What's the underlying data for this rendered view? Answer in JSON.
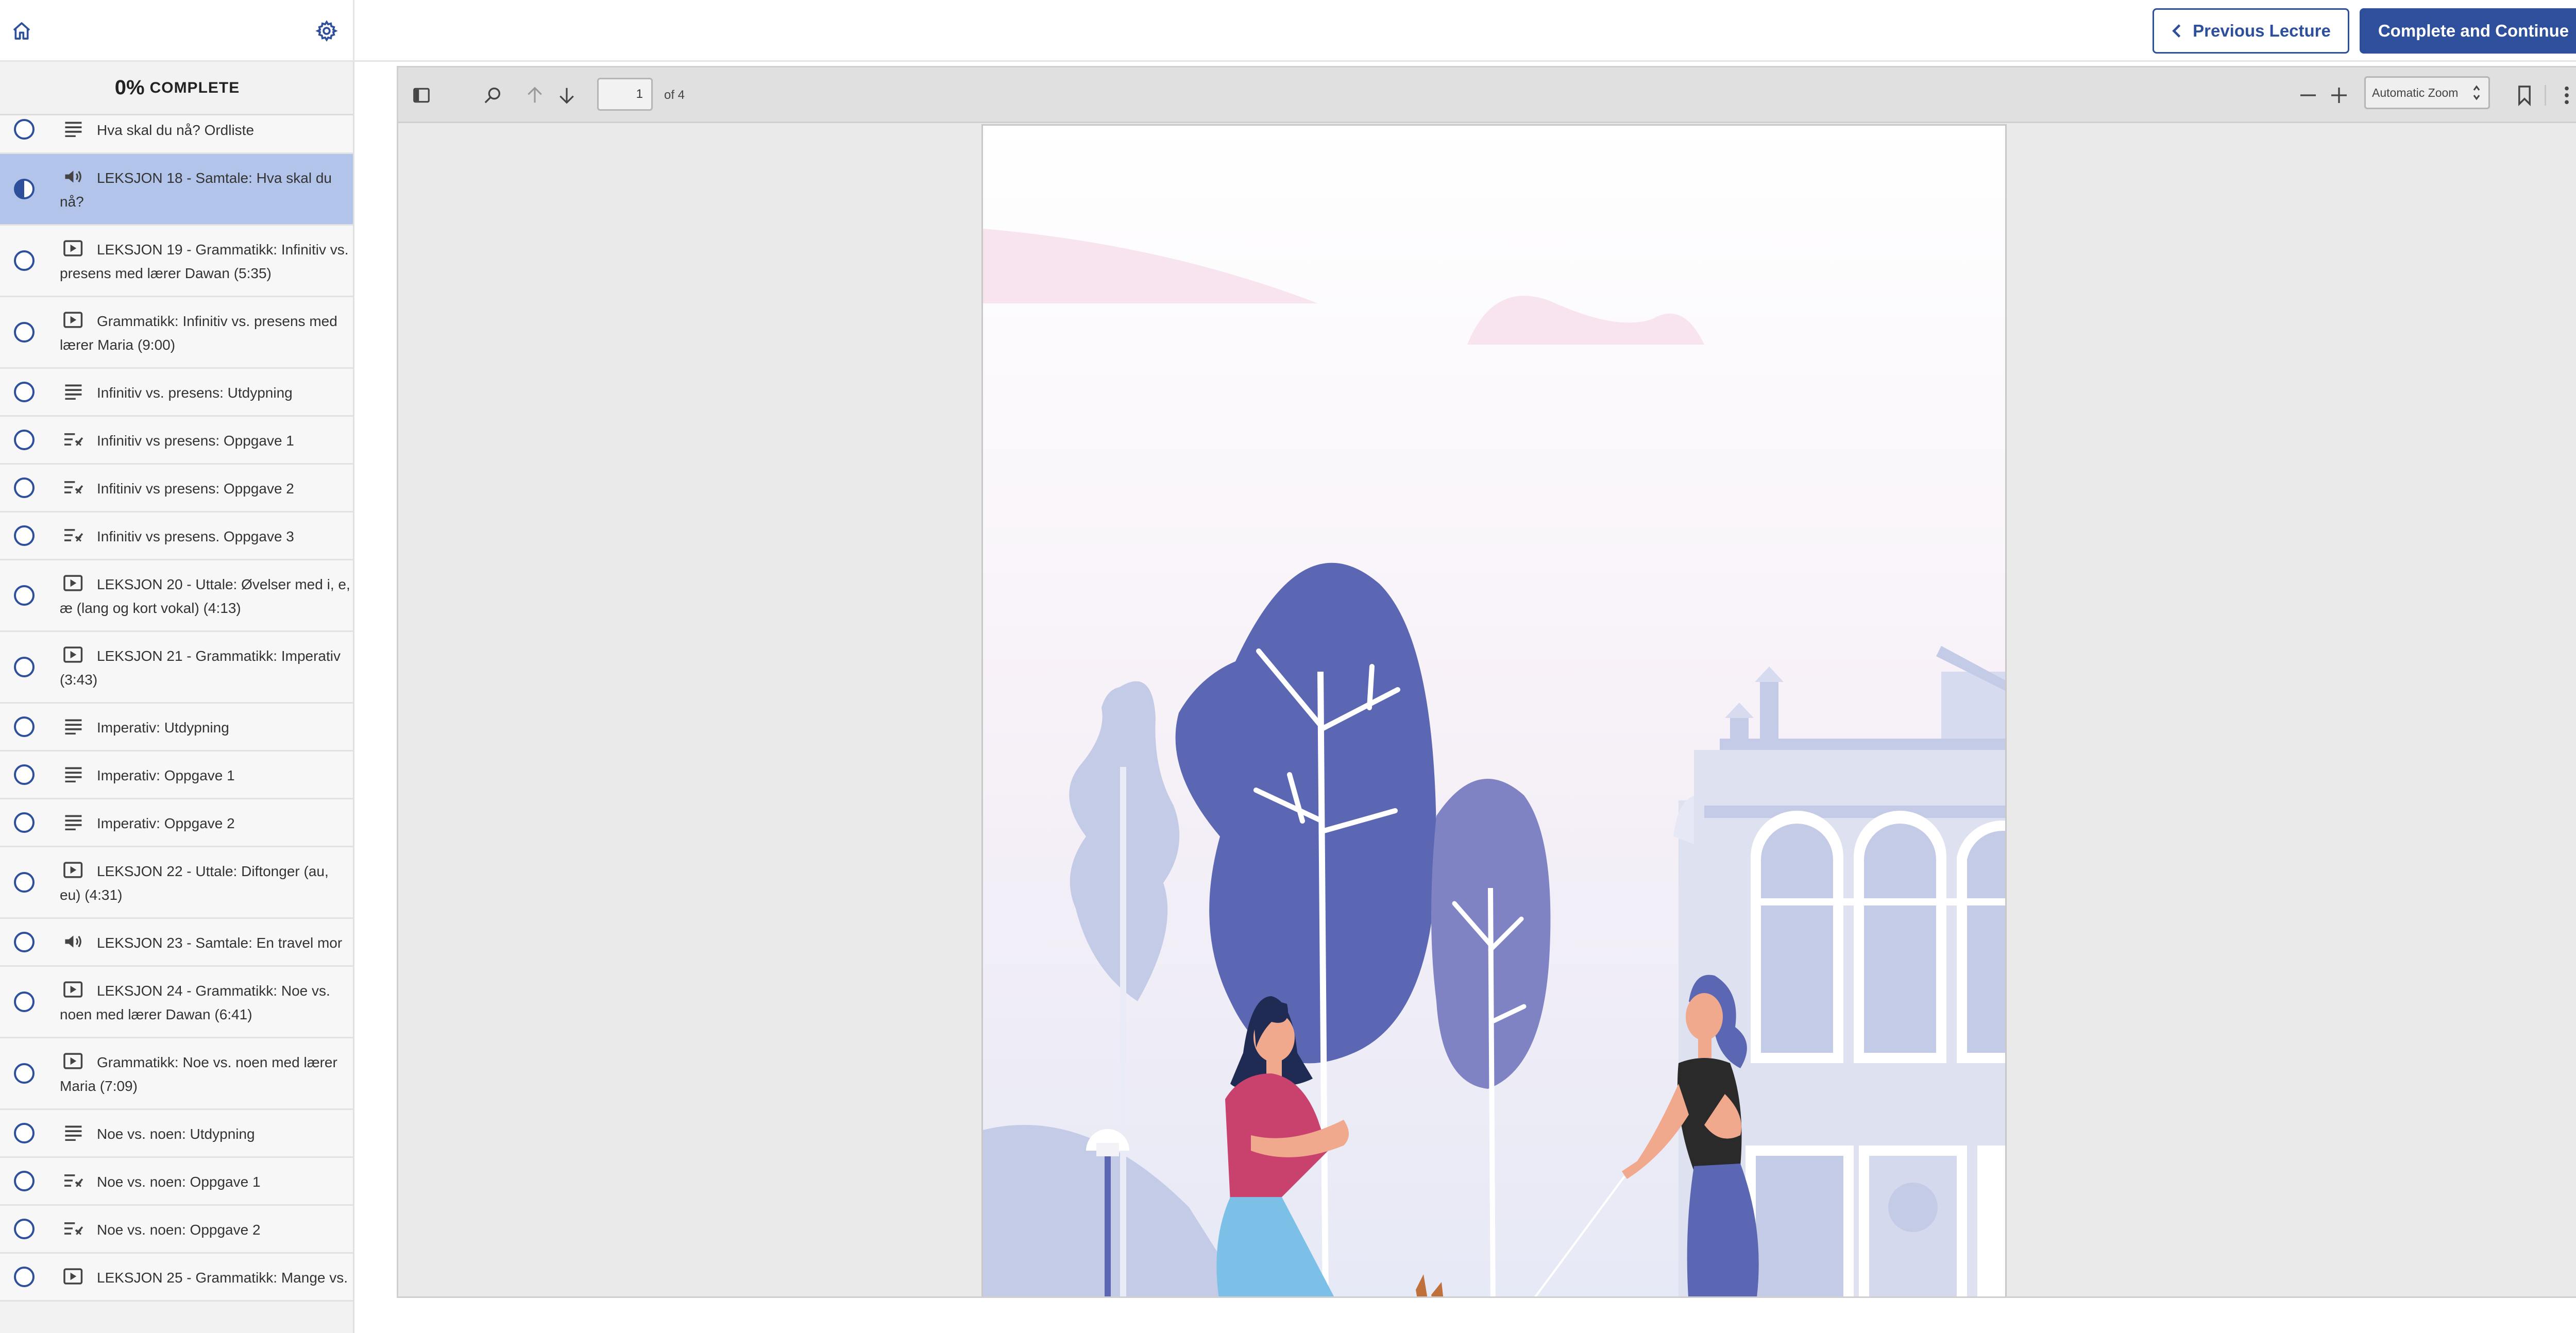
{
  "header": {
    "prev_label": "Previous Lecture",
    "next_label": "Complete and Continue"
  },
  "sidebar": {
    "progress_percent": "0%",
    "progress_label": "COMPLETE",
    "lectures": [
      {
        "type": "text",
        "title": "Hva skal du nå? Ordliste",
        "status": "empty"
      },
      {
        "type": "audio",
        "title": "LEKSJON 18 - Samtale: Hva skal du nå?",
        "status": "half",
        "active": true
      },
      {
        "type": "video",
        "title": "LEKSJON 19 - Grammatikk: Infinitiv vs. presens med lærer Dawan (5:35)",
        "status": "empty"
      },
      {
        "type": "video",
        "title": "Grammatikk: Infinitiv vs. presens med lærer Maria (9:00)",
        "status": "empty"
      },
      {
        "type": "text",
        "title": "Infinitiv vs. presens: Utdypning",
        "status": "empty"
      },
      {
        "type": "quiz",
        "title": "Infinitiv vs presens: Oppgave 1",
        "status": "empty"
      },
      {
        "type": "quiz",
        "title": "Infitiniv vs presens: Oppgave 2",
        "status": "empty"
      },
      {
        "type": "quiz",
        "title": "Infinitiv vs presens. Oppgave 3",
        "status": "empty"
      },
      {
        "type": "video",
        "title": "LEKSJON 20 - Uttale: Øvelser med i, e, æ (lang og kort vokal) (4:13)",
        "status": "empty"
      },
      {
        "type": "video",
        "title": "LEKSJON 21 - Grammatikk: Imperativ (3:43)",
        "status": "empty"
      },
      {
        "type": "text",
        "title": "Imperativ: Utdypning",
        "status": "empty"
      },
      {
        "type": "text",
        "title": "Imperativ: Oppgave 1",
        "status": "empty"
      },
      {
        "type": "text",
        "title": "Imperativ: Oppgave 2",
        "status": "empty"
      },
      {
        "type": "video",
        "title": "LEKSJON 22 - Uttale: Diftonger (au, eu) (4:31)",
        "status": "empty"
      },
      {
        "type": "audio",
        "title": "LEKSJON 23 - Samtale: En travel mor",
        "status": "empty"
      },
      {
        "type": "video",
        "title": "LEKSJON 24 - Grammatikk: Noe vs. noen med lærer Dawan (6:41)",
        "status": "empty"
      },
      {
        "type": "video",
        "title": "Grammatikk: Noe vs. noen med lærer Maria (7:09)",
        "status": "empty"
      },
      {
        "type": "text",
        "title": "Noe vs. noen: Utdypning",
        "status": "empty"
      },
      {
        "type": "quiz",
        "title": "Noe vs. noen: Oppgave 1",
        "status": "empty"
      },
      {
        "type": "quiz",
        "title": "Noe vs. noen: Oppgave 2",
        "status": "empty"
      },
      {
        "type": "video",
        "title": "LEKSJON 25 - Grammatikk: Mange vs.",
        "status": "empty"
      }
    ]
  },
  "viewer": {
    "page_value": "1",
    "page_of": "of 4",
    "zoom": "Automatic Zoom"
  },
  "icons": {
    "home": "home-icon",
    "settings": "gear-icon",
    "sidebar_toggle": "sidebar-toggle-icon",
    "find": "search-icon",
    "prev_page": "arrow-up-icon",
    "next_page": "arrow-down-icon",
    "zoom_out": "minus-icon",
    "zoom_in": "plus-icon",
    "bookmark": "bookmark-icon",
    "more": "more-vertical-icon"
  },
  "colors": {
    "brand": "#2e4f9b",
    "active_item": "#b3c4ea"
  }
}
